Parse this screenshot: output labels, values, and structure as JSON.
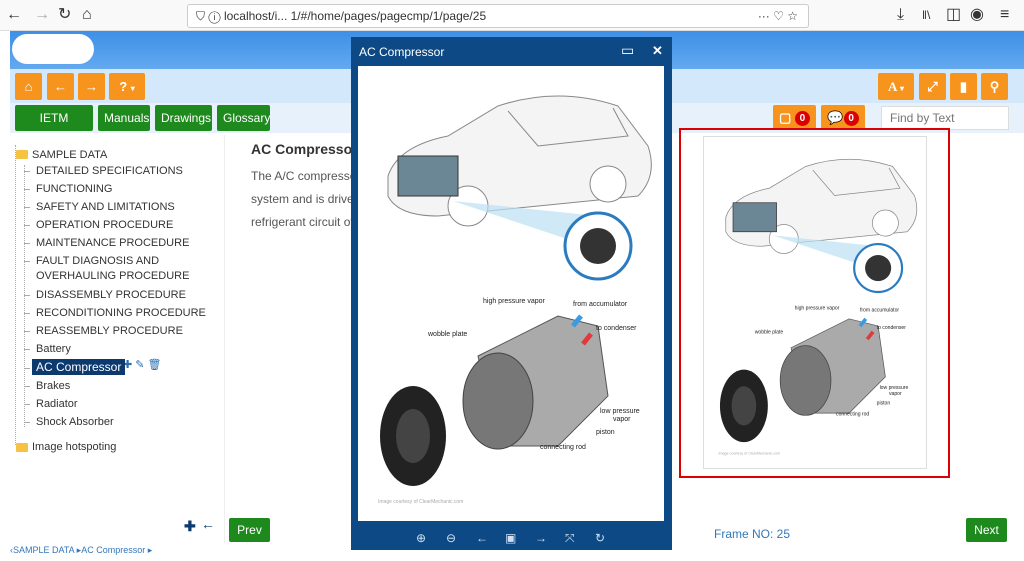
{
  "browser": {
    "url": "localhost/i...    1/#/home/pages/pagecmp/1/page/25",
    "more": "···"
  },
  "toolbar": {
    "home": "home-icon",
    "back": "arrow-left-icon",
    "forward": "arrow-right-icon",
    "help": "question-icon",
    "font": "A",
    "font_caret": "▾"
  },
  "nav": {
    "tabs": [
      "IETM Content",
      "Manuals",
      "Drawings",
      "Glossary"
    ],
    "notes_count": "0",
    "comments_count": "0",
    "find_placeholder": "Find by Text"
  },
  "tree": {
    "root": "SAMPLE DATA",
    "items": [
      "DETAILED SPECIFICATIONS",
      "FUNCTIONING",
      "SAFETY AND LIMITATIONS",
      "OPERATION PROCEDURE",
      "MAINTENANCE PROCEDURE",
      "FAULT DIAGNOSIS AND",
      "OVERHAULING PROCEDURE",
      "DISASSEMBLY PROCEDURE",
      "RECONDITIONING PROCEDURE",
      "REASSEMBLY PROCEDURE",
      "Battery",
      "AC Compressor",
      "Brakes",
      "Radiator",
      "Shock Absorber"
    ],
    "selected": "AC Compressor",
    "second_root": "Image hotspoting"
  },
  "content": {
    "title": "AC Compressor",
    "lines": [
      "The A/C compresso",
      "system and is drive",
      "refrigerant circuit of"
    ]
  },
  "dialog": {
    "title": "AC Compressor"
  },
  "figure": {
    "labels": {
      "hpv": "high pressure vapor",
      "acc": "from accumulator",
      "cond": "to condenser",
      "wobble": "wobble plate",
      "lpv1": "low pressure",
      "lpv2": "vapor",
      "piston": "piston",
      "rod": "connecting rod"
    },
    "credit": "Image courtesy of ClearMechanic.com"
  },
  "footer": {
    "prev": "Prev",
    "next": "Next",
    "frame": "Frame NO: 25",
    "breadcrumb": "‹SAMPLE DATA ▸AC Compressor ▸"
  },
  "colors": {
    "orange": "#f7941d",
    "green": "#1e8a1e",
    "dialog": "#0d4a85",
    "highlight": "#d00000"
  }
}
